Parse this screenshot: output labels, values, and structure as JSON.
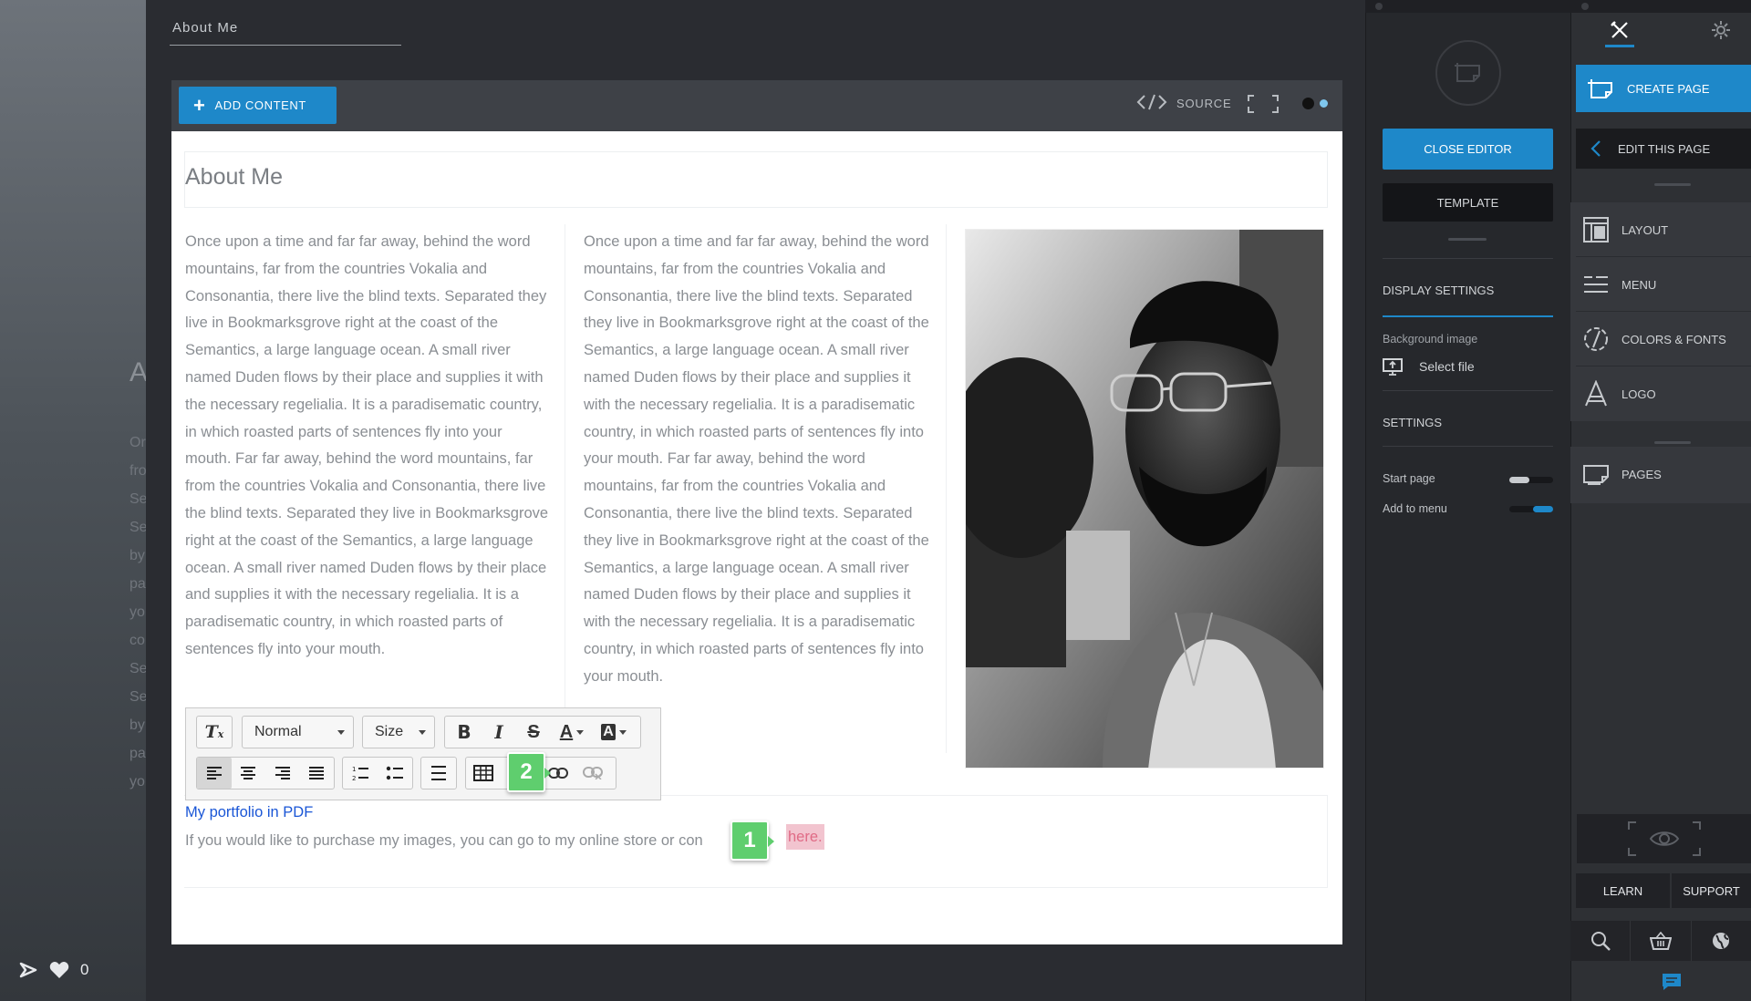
{
  "page_title": "About Me",
  "left_ghost": {
    "title": "A",
    "lines": [
      "Or",
      "fro",
      "Se",
      "Se",
      "by",
      "pa",
      "yo",
      "co",
      "Se",
      "Se",
      "by",
      "pa",
      "yo"
    ]
  },
  "left_bottom": {
    "like_count": "0"
  },
  "toolbar": {
    "add_content": "ADD CONTENT",
    "source": "SOURCE",
    "dot_colors": [
      "#111111",
      "#7fc7ee"
    ]
  },
  "content": {
    "heading": "About Me",
    "column1": "Once upon a time and far far away, behind the word mountains, far from the countries Vokalia and Consonantia, there live the blind texts. Separated they live in Bookmarksgrove right at the coast of the Semantics, a large language ocean. A small river named Duden flows by their place and supplies it with the necessary regelialia. It is a paradisematic country, in which roasted parts of sentences fly into your mouth. Far far away, behind the word mountains, far from the countries Vokalia and Consonantia, there live the blind texts. Separated they live in Bookmarksgrove right at the coast of the Semantics, a large language ocean. A small river named Duden flows by their place and supplies it with the necessary regelialia.  It is a paradisematic country, in which roasted parts of sentences fly into your mouth.",
    "column2": "Once upon a time and far far away, behind the word mountains, far from the countries Vokalia and Consonantia, there live the blind texts. Separated they live in Bookmarksgrove right at the coast of the Semantics, a large language ocean. A small river named Duden flows by their place and supplies it with the necessary regelialia. It is a paradisematic country, in which roasted parts of sentences fly into your mouth. Far far away, behind the word mountains, far from the countries Vokalia and Consonantia, there live the blind texts. Separated they live in Bookmarksgrove right at the coast of the Semantics, a large language ocean. A small river named Duden flows by their place and supplies it with the necessary regelialia.  It is a paradisematic country, in which roasted parts of sentences fly into your mouth.",
    "link_text": "My portfolio in PDF",
    "paragraph_prefix": "If you would like to purchase my images, you can go to my online store or con",
    "selected_link": "here."
  },
  "format_toolbar": {
    "format_value": "Normal",
    "size_value": "Size",
    "bold": "B",
    "italic": "I",
    "strike": "S",
    "font_color": "A",
    "bg_color": "A"
  },
  "badges": {
    "one": "1",
    "two": "2"
  },
  "middle_panel": {
    "close_editor": "CLOSE EDITOR",
    "template": "TEMPLATE",
    "display_settings": "DISPLAY SETTINGS",
    "background_image": "Background image",
    "select_file": "Select file",
    "settings": "SETTINGS",
    "start_page": "Start page",
    "add_to_menu": "Add to menu",
    "start_page_on": false,
    "add_to_menu_on": true
  },
  "right_panel": {
    "create_page": "CREATE PAGE",
    "edit_this_page": "EDIT THIS PAGE",
    "items": [
      "LAYOUT",
      "MENU",
      "COLORS & FONTS",
      "LOGO"
    ],
    "pages": "PAGES",
    "learn": "LEARN",
    "support": "SUPPORT"
  },
  "colors": {
    "accent": "#1e88c9",
    "badge": "#5fce6e",
    "link": "#1a56d6",
    "highlight": "#f2c4cf"
  }
}
